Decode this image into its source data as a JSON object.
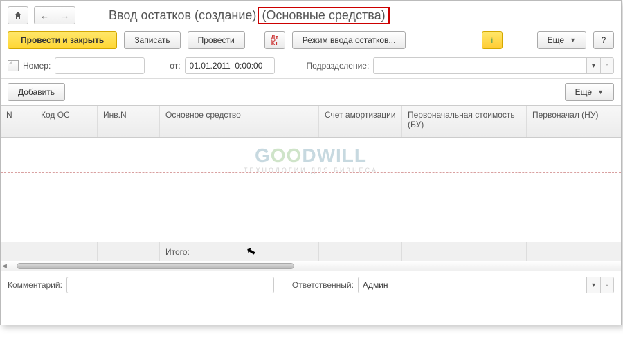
{
  "title": {
    "main": "Ввод остатков (создание)",
    "suffix": "(Основные средства)"
  },
  "toolbar": {
    "post_close": "Провести и закрыть",
    "save": "Записать",
    "post": "Провести",
    "mode": "Режим ввода остатков...",
    "more": "Еще",
    "help": "?"
  },
  "form": {
    "number_label": "Номер:",
    "number_value": "",
    "from_label": "от:",
    "date_value": "01.01.2011  0:00:00",
    "subdivision_label": "Подразделение:",
    "subdivision_value": ""
  },
  "tab_toolbar": {
    "add": "Добавить",
    "more": "Еще"
  },
  "columns": {
    "n": "N",
    "code": "Код ОС",
    "inv": "Инв.N",
    "asset": "Основное средство",
    "acct": "Счет амортизации",
    "cost_bu": "Первоначальная стоимость (БУ)",
    "cost_nu": "Первоначал (НУ)"
  },
  "footer": {
    "total": "Итого:"
  },
  "bottom": {
    "comment_label": "Комментарий:",
    "comment_value": "",
    "responsible_label": "Ответственный:",
    "responsible_value": "Админ"
  },
  "watermark": {
    "g": "G",
    "oo": "OO",
    "dwill": "DWILL",
    "sub": "ТЕХНОЛОГИИ ДЛЯ БИЗНЕСA"
  }
}
